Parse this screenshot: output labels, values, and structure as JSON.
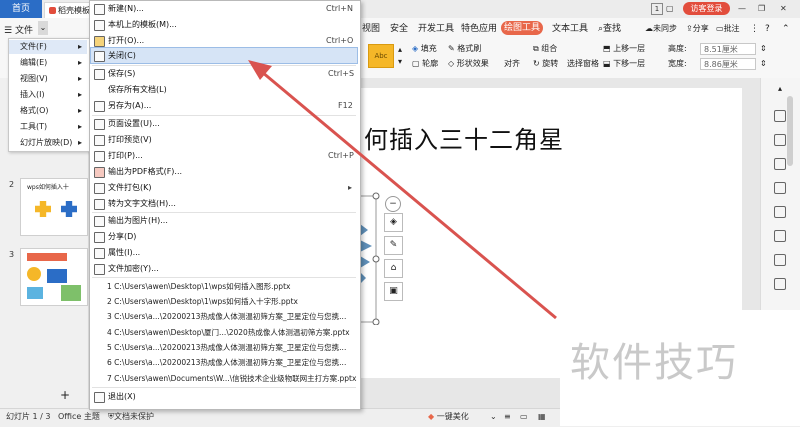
{
  "titlebar": {
    "home": "首页",
    "doc_tab": "稻壳模板",
    "page_num": "1",
    "login": "访客登录"
  },
  "menubar": {
    "file": "文件",
    "tabs": [
      "视图",
      "安全",
      "开发工具",
      "特色应用",
      "绘图工具",
      "文本工具"
    ],
    "search": "查找",
    "sync": "未同步",
    "share": "分享",
    "comment": "批注"
  },
  "ribbon": {
    "shape_label": "Abc",
    "fill": "填充",
    "format_brush": "格式刷",
    "outline": "轮廓",
    "shape_effects": "形状效果",
    "group": "组合",
    "rotate": "旋转",
    "select_pane": "选择窗格",
    "align": "对齐",
    "bring_forward": "上移一层",
    "send_backward": "下移一层",
    "height_label": "高度:",
    "height_value": "8.51厘米",
    "width_label": "宽度:",
    "width_value": "8.86厘米"
  },
  "left_menu": {
    "items": [
      "文件(F)",
      "编辑(E)",
      "视图(V)",
      "插入(I)",
      "格式(O)",
      "工具(T)",
      "幻灯片放映(D)"
    ]
  },
  "file_menu": {
    "items": [
      {
        "label": "新建(N)...",
        "shortcut": "Ctrl+N"
      },
      {
        "label": "本机上的模板(M)...",
        "shortcut": ""
      },
      {
        "label": "打开(O)...",
        "shortcut": "Ctrl+O"
      },
      {
        "label": "关闭(C)",
        "shortcut": ""
      },
      {
        "label": "保存(S)",
        "shortcut": "Ctrl+S"
      },
      {
        "label": "保存所有文档(L)",
        "shortcut": ""
      },
      {
        "label": "另存为(A)...",
        "shortcut": "F12"
      },
      {
        "label": "页面设置(U)...",
        "shortcut": ""
      },
      {
        "label": "打印预览(V)",
        "shortcut": ""
      },
      {
        "label": "打印(P)...",
        "shortcut": "Ctrl+P"
      },
      {
        "label": "输出为PDF格式(F)...",
        "shortcut": ""
      },
      {
        "label": "文件打包(K)",
        "shortcut": ""
      },
      {
        "label": "转为文字文档(H)...",
        "shortcut": ""
      },
      {
        "label": "输出为图片(H)...",
        "shortcut": ""
      },
      {
        "label": "分享(D)",
        "shortcut": ""
      },
      {
        "label": "属性(I)...",
        "shortcut": ""
      },
      {
        "label": "文件加密(Y)...",
        "shortcut": ""
      }
    ],
    "recent": [
      "1 C:\\Users\\awen\\Desktop\\1\\wps如何插入图形.pptx",
      "2 C:\\Users\\awen\\Desktop\\1\\wps如何插入十字形.pptx",
      "3 C:\\Users\\a...\\20200213热成像人体测温初筛方案_卫星定位与您携...",
      "4 C:\\Users\\awen\\Desktop\\厦门...\\2020热成像人体测温初筛方案.pptx",
      "5 C:\\Users\\a...\\20200213热成像人体测温初筛方案_卫星定位与您携...",
      "6 C:\\Users\\a...\\20200213热成像人体测温初筛方案_卫星定位与您携...",
      "7 C:\\Users\\awen\\Documents\\W...\\信锐技术企业级物联网主打方案.pptx"
    ],
    "exit": "退出(X)"
  },
  "slides": {
    "slide2_title": "wps如何插入十",
    "numbers": [
      "2",
      "3"
    ]
  },
  "slide": {
    "title": "何插入三十二角星"
  },
  "statusbar": {
    "slide_count": "幻灯片 1 / 3",
    "theme": "Office 主题",
    "protect": "文档未保护",
    "beautify": "一键美化"
  },
  "watermark": "软件技巧",
  "colors": {
    "accent": "#2b6dc6",
    "drawing_tab": "#e8674a",
    "login": "#e24d3c",
    "arrow": "#d9534f"
  }
}
